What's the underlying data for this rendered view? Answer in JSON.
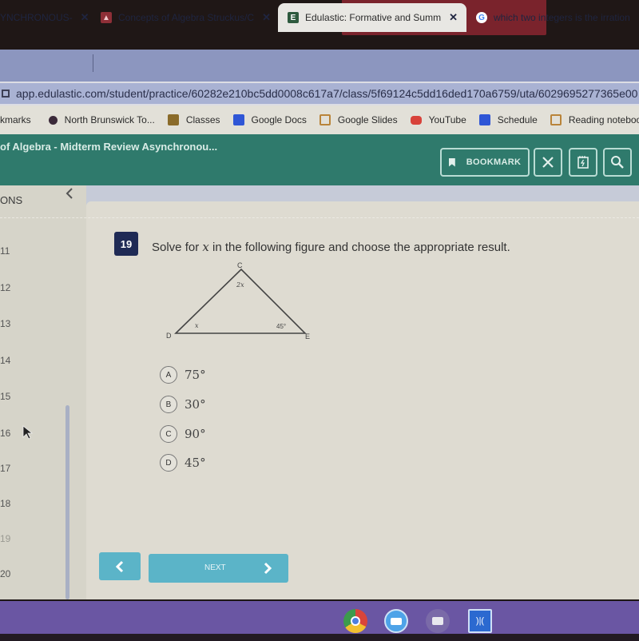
{
  "browser": {
    "tabs": [
      {
        "label": "YNCHRONOUS-",
        "active": false,
        "icon": "edulastic-icon"
      },
      {
        "label": "Concepts of Algebra Struckus/C",
        "active": false,
        "icon": "classroom-icon"
      },
      {
        "label": "Edulastic: Formative and Summ",
        "active": true,
        "icon": "edulastic-icon"
      },
      {
        "label": "which two integers is the irration",
        "active": false,
        "icon": "google-icon"
      }
    ],
    "url": "app.edulastic.com/student/practice/60282e210bc5dd0008c617a7/class/5f69124c5dd16ded170a6759/uta/6029695277365e00",
    "bookmarks": [
      {
        "label": "kmarks",
        "icon": "none"
      },
      {
        "label": "North Brunswick To...",
        "icon": "school-icon"
      },
      {
        "label": "Classes",
        "icon": "classroom-icon"
      },
      {
        "label": "Google Docs",
        "icon": "docs-icon"
      },
      {
        "label": "Google Slides",
        "icon": "slides-icon"
      },
      {
        "label": "YouTube",
        "icon": "youtube-icon"
      },
      {
        "label": "Schedule",
        "icon": "docs-icon"
      },
      {
        "label": "Reading notebook",
        "icon": "slides-icon"
      }
    ]
  },
  "app": {
    "title": "of Algebra - Midterm Review Asynchronou...",
    "header_buttons": {
      "bookmark": "BOOKMARK"
    },
    "colors": {
      "header": "#2f7a6c",
      "question_badge": "#1f2a55",
      "nav_button": "#5bb4c8"
    }
  },
  "sidebar": {
    "heading": "ONS",
    "items": [
      "11",
      "12",
      "13",
      "14",
      "15",
      "16",
      "17",
      "18",
      "19",
      "20"
    ]
  },
  "question": {
    "number": "19",
    "text_before": "Solve for ",
    "variable": "x",
    "text_after": " in the following figure and choose the appropriate result.",
    "figure": {
      "vertices": {
        "top": "C",
        "left": "D",
        "right": "E"
      },
      "angles": {
        "C": "2x",
        "D": "x",
        "E": "45°"
      }
    },
    "options": [
      {
        "letter": "A",
        "value": "75°"
      },
      {
        "letter": "B",
        "value": "30°"
      },
      {
        "letter": "C",
        "value": "90°"
      },
      {
        "letter": "D",
        "value": "45°"
      }
    ]
  },
  "navigation": {
    "next_label": "NEXT"
  },
  "shelf": {
    "apps": [
      "chrome-icon",
      "zoom-icon",
      "camera-icon",
      "text-to-speech-icon"
    ]
  }
}
